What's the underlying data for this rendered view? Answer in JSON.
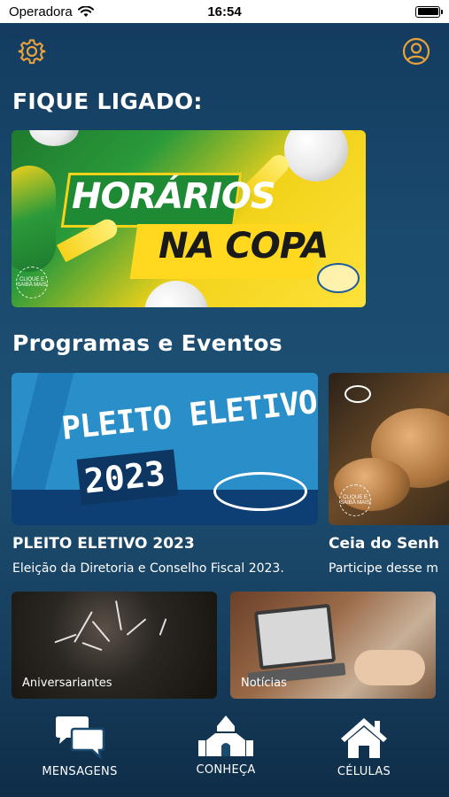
{
  "status_bar": {
    "carrier": "Operadora",
    "time": "16:54"
  },
  "header": {
    "settings_icon": "gear-icon",
    "profile_icon": "user-circle-icon"
  },
  "featured": {
    "heading": "FIQUE LIGADO:",
    "banner": {
      "line1": "HORÁRIOS",
      "line2": "NA COPA",
      "badge": "CLIQUE E SAIBA MAIS"
    }
  },
  "programs": {
    "heading": "Programas e Eventos",
    "items": [
      {
        "title": "PLEITO ELETIVO 2023",
        "description": "Eleição da Diretoria e Conselho Fiscal 2023.",
        "art_line1": "PLEITO ELETIVO",
        "art_line2": "2023"
      },
      {
        "title": "Ceia do Senh",
        "description": "Participe desse m",
        "badge": "CLIQUE E SAIBA MAIS"
      }
    ]
  },
  "shortcuts": [
    {
      "label": "Aniversariantes"
    },
    {
      "label": "Notícias"
    }
  ],
  "tab_bar": {
    "items": [
      {
        "label": "MENSAGENS",
        "icon": "chat-bubbles-icon"
      },
      {
        "label": "CONHEÇA",
        "icon": "church-icon"
      },
      {
        "label": "CÉLULAS",
        "icon": "home-icon"
      }
    ]
  },
  "colors": {
    "accent": "#e9a23b",
    "background": "#1a4a6e"
  }
}
